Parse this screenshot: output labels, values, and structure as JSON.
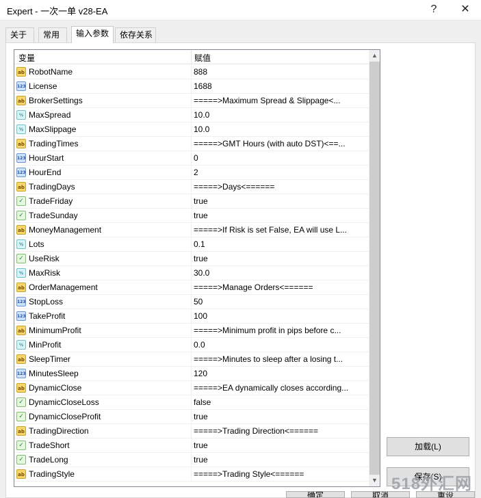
{
  "window": {
    "title": "Expert - 一次一单 v28-EA",
    "help_label": "?",
    "close_label": "✕"
  },
  "tabs": [
    {
      "label": "关于"
    },
    {
      "label": "常用"
    },
    {
      "label": "输入参数",
      "active": true
    },
    {
      "label": "依存关系"
    }
  ],
  "grid": {
    "col_variable": "变量",
    "col_value": "赋值",
    "scroll_up": "▲",
    "scroll_down": "▼",
    "rows": [
      {
        "type": "ab",
        "name": "RobotName",
        "value": "888"
      },
      {
        "type": "int",
        "name": "License",
        "value": "1688"
      },
      {
        "type": "ab",
        "name": "BrokerSettings",
        "value": "=====>Maximum Spread & Slippage<..."
      },
      {
        "type": "dbl",
        "name": "MaxSpread",
        "value": "10.0"
      },
      {
        "type": "dbl",
        "name": "MaxSlippage",
        "value": "10.0"
      },
      {
        "type": "ab",
        "name": "TradingTimes",
        "value": "=====>GMT Hours (with auto DST)<==..."
      },
      {
        "type": "int",
        "name": "HourStart",
        "value": "0"
      },
      {
        "type": "int",
        "name": "HourEnd",
        "value": "2"
      },
      {
        "type": "ab",
        "name": "TradingDays",
        "value": "=====>Days<======"
      },
      {
        "type": "bool",
        "name": "TradeFriday",
        "value": "true"
      },
      {
        "type": "bool",
        "name": "TradeSunday",
        "value": "true"
      },
      {
        "type": "ab",
        "name": "MoneyManagement",
        "value": "=====>If Risk is set False, EA will use L..."
      },
      {
        "type": "dbl",
        "name": "Lots",
        "value": "0.1"
      },
      {
        "type": "bool",
        "name": "UseRisk",
        "value": "true"
      },
      {
        "type": "dbl",
        "name": "MaxRisk",
        "value": "30.0"
      },
      {
        "type": "ab",
        "name": "OrderManagement",
        "value": "=====>Manage Orders<======"
      },
      {
        "type": "int",
        "name": "StopLoss",
        "value": "50"
      },
      {
        "type": "int",
        "name": "TakeProfit",
        "value": "100"
      },
      {
        "type": "ab",
        "name": "MinimumProfit",
        "value": "=====>Minimum profit in pips before c..."
      },
      {
        "type": "dbl",
        "name": "MinProfit",
        "value": "0.0"
      },
      {
        "type": "ab",
        "name": "SleepTimer",
        "value": "=====>Minutes to sleep after a losing t..."
      },
      {
        "type": "int",
        "name": "MinutesSleep",
        "value": "120"
      },
      {
        "type": "ab",
        "name": "DynamicClose",
        "value": "=====>EA dynamically closes according..."
      },
      {
        "type": "bool",
        "name": "DynamicCloseLoss",
        "value": "false"
      },
      {
        "type": "bool",
        "name": "DynamicCloseProfit",
        "value": "true"
      },
      {
        "type": "ab",
        "name": "TradingDirection",
        "value": "=====>Trading Direction<======"
      },
      {
        "type": "bool",
        "name": "TradeShort",
        "value": "true"
      },
      {
        "type": "bool",
        "name": "TradeLong",
        "value": "true"
      },
      {
        "type": "ab",
        "name": "TradingStyle",
        "value": "=====>Trading Style<======"
      }
    ]
  },
  "icons": {
    "ab": "string-type-icon",
    "int": "integer-type-icon",
    "dbl": "double-type-icon",
    "bool": "bool-type-icon"
  },
  "icon_glyphs": {
    "ab": "ab",
    "int": "123",
    "dbl": "½",
    "bool": "✓"
  },
  "buttons": {
    "load_label": "加载(L)",
    "save_label": "保存(S)",
    "ok_label": "确定",
    "cancel_label": "取消",
    "reset_label": "重设"
  },
  "watermark": "518外汇网"
}
